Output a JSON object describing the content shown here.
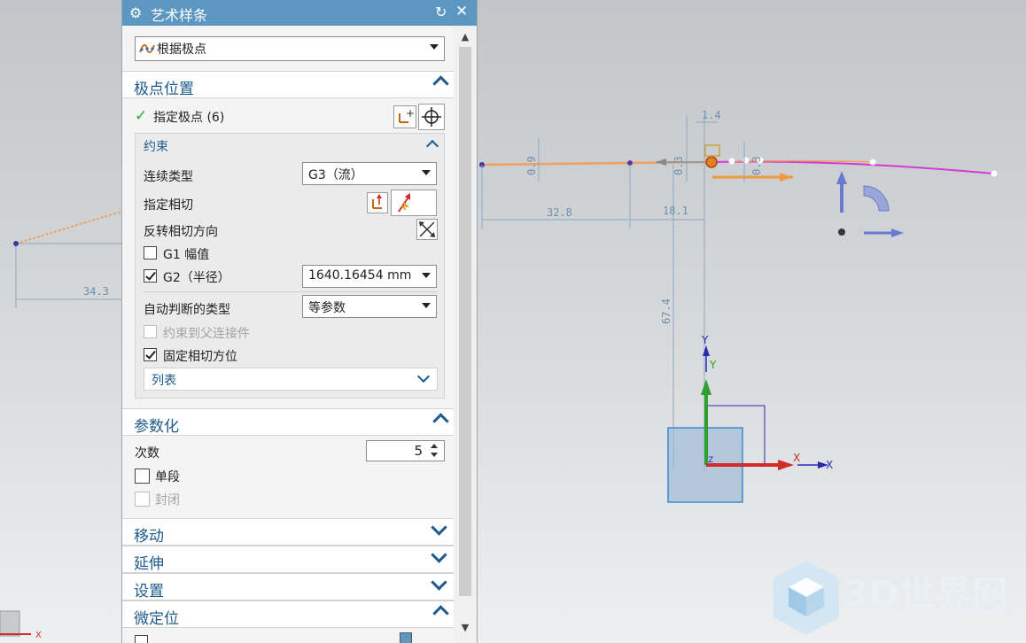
{
  "dialog": {
    "title": "艺术样条",
    "method_select": "根据极点",
    "sections": {
      "pole_position": "极点位置",
      "parameterization": "参数化",
      "move": "移动",
      "extend": "延伸",
      "settings": "设置",
      "fine_positioning": "微定位"
    },
    "specify_poles": "指定极点 (6)",
    "constraints": {
      "title": "约束",
      "continuity_label": "连续类型",
      "continuity_value": "G3（流）",
      "specify_tangent": "指定相切",
      "reverse_tangent": "反转相切方向",
      "g1_label": "G1 幅值",
      "g1_checked": false,
      "g2_label": "G2（半径）",
      "g2_checked": true,
      "g2_value": "1640.16454 mm",
      "auto_type_label": "自动判断的类型",
      "auto_type_value": "等参数",
      "constrain_parent_label": "约束到父连接件",
      "fix_tangent_label": "固定相切方位",
      "fix_tangent_checked": true,
      "list_label": "列表"
    },
    "parameterization": {
      "degree_label": "次数",
      "degree_value": "5",
      "single_segment": "单段",
      "closed": "封闭"
    }
  },
  "viewport": {
    "dimensions": [
      "34.3",
      "32.8",
      "18.1",
      "67.4",
      "0.9",
      "1.4",
      "0.3",
      "0.3"
    ],
    "axis_x": "X",
    "axis_y": "Y",
    "axis_z": "Z"
  },
  "watermark": {
    "brand": "3D世界网",
    "url": "WWW.3DSJW.COM"
  }
}
